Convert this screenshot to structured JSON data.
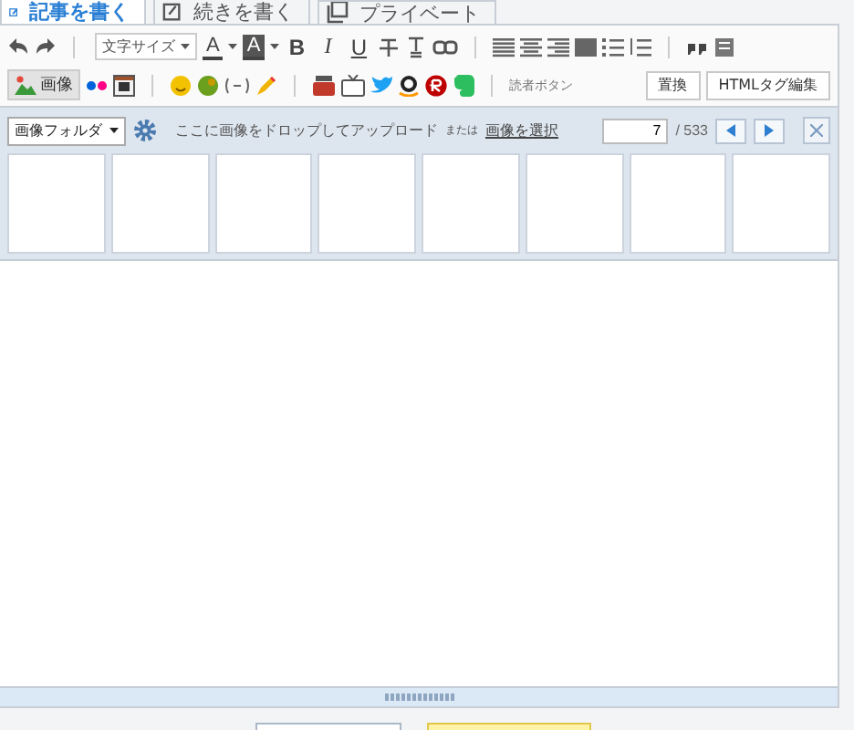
{
  "tabs": [
    {
      "label": "記事を書く",
      "selected": true
    },
    {
      "label": "続きを書く",
      "selected": false
    },
    {
      "label": "プライベート",
      "selected": false
    }
  ],
  "toolbar": {
    "font_size": "文字サイズ",
    "text_color": "A",
    "highlight_color": "A",
    "format_buttons": [
      {
        "label": "B",
        "kind": "bold"
      },
      {
        "label": "I",
        "kind": "italic"
      },
      {
        "label": "U",
        "kind": "underline"
      }
    ],
    "image_button": {
      "label": "画像",
      "selected": true
    },
    "reader_button": "読者ボタン",
    "buttons": [
      "置換",
      "HTMLタグ編集"
    ]
  },
  "image_panel": {
    "folder": "画像フォルダ",
    "drop_text": "ここに画像をドロップしてアップロード",
    "or_text": "または",
    "select_link": "画像を選択",
    "page": "7",
    "total": "/ 533"
  }
}
